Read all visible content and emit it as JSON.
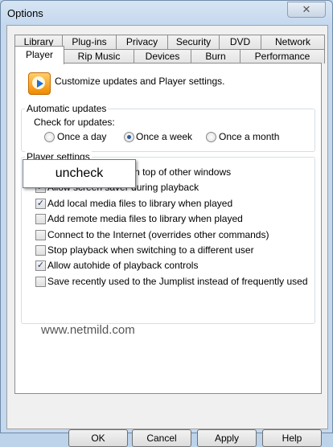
{
  "window": {
    "title": "Options",
    "close_glyph": "✕"
  },
  "tabs_row1": [
    {
      "label": "Library"
    },
    {
      "label": "Plug-ins"
    },
    {
      "label": "Privacy"
    },
    {
      "label": "Security"
    },
    {
      "label": "DVD"
    },
    {
      "label": "Network"
    }
  ],
  "tabs_row2": [
    {
      "label": "Player",
      "selected": true
    },
    {
      "label": "Rip Music"
    },
    {
      "label": "Devices"
    },
    {
      "label": "Burn"
    },
    {
      "label": "Performance"
    }
  ],
  "intro": {
    "text": "Customize updates and Player settings.",
    "icon": "media-player-icon"
  },
  "automatic_updates": {
    "label": "Automatic updates",
    "check_label": "Check for updates:",
    "options": [
      {
        "label": "Once a day",
        "checked": false
      },
      {
        "label": "Once a week",
        "checked": true
      },
      {
        "label": "Once a month",
        "checked": false
      }
    ]
  },
  "player_settings": {
    "label": "Player settings",
    "items": [
      {
        "label": "Keep Now Playing on top of other windows",
        "checked": false
      },
      {
        "label": "Allow screen saver during playback",
        "checked": true
      },
      {
        "label": "Add local media files to library when played",
        "checked": true
      },
      {
        "label": "Add remote media files to library when played",
        "checked": false
      },
      {
        "label": "Connect to the Internet (overrides other commands)",
        "checked": false
      },
      {
        "label": "Stop playback when switching to a different user",
        "checked": false
      },
      {
        "label": "Allow autohide of playback controls",
        "checked": true
      },
      {
        "label": "Save recently used to the Jumplist instead of frequently used",
        "checked": false
      }
    ]
  },
  "annotation": {
    "text": "uncheck",
    "arrow_color": "#cc1a1a"
  },
  "watermark": "www.netmild.com",
  "buttons": {
    "ok": "OK",
    "cancel": "Cancel",
    "apply": "Apply",
    "help": "Help"
  },
  "check_glyph": "✓"
}
